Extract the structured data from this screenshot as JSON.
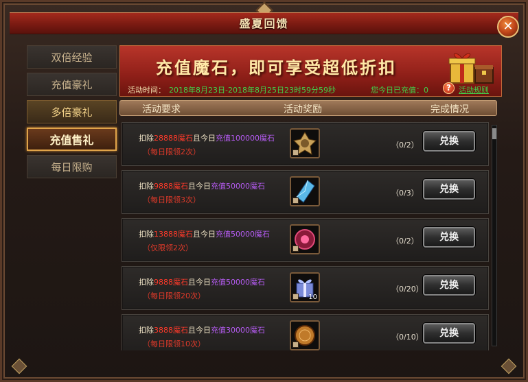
{
  "window": {
    "title": "盛夏回馈"
  },
  "tabs": [
    {
      "label": "双倍经验"
    },
    {
      "label": "充值豪礼"
    },
    {
      "label": "多倍豪礼"
    },
    {
      "label": "充值售礼"
    },
    {
      "label": "每日限购"
    }
  ],
  "banner": {
    "headline": "充值魔石，即可享受超低折扣",
    "time_label": "活动时间：",
    "time_range": "2018年8月23日-2018年8月25日23时59分59秒",
    "charged_text": "您今日已充值：0",
    "help_glyph": "?",
    "rules_link": "活动规则"
  },
  "columns": {
    "requirement": "活动要求",
    "reward": "活动奖励",
    "status": "完成情况"
  },
  "rows": [
    {
      "deduct_prefix": "扣除",
      "deduct_amount": "28888魔石",
      "mid": "且今日",
      "charge_text": "充值100000魔石",
      "limit": "（每日限领2次）",
      "item_icon": "medal-icon",
      "item_qty": "",
      "progress": "（0/2）",
      "button": "兑换"
    },
    {
      "deduct_prefix": "扣除",
      "deduct_amount": "9888魔石",
      "mid": "且今日",
      "charge_text": "充值50000魔石",
      "limit": "（每日限领3次）",
      "item_icon": "crystal-icon",
      "item_qty": "",
      "progress": "（0/3）",
      "button": "兑换"
    },
    {
      "deduct_prefix": "扣除",
      "deduct_amount": "13888魔石",
      "mid": "且今日",
      "charge_text": "充值50000魔石",
      "limit": "（仅限领2次）",
      "item_icon": "orb-icon",
      "item_qty": "",
      "progress": "（0/2）",
      "button": "兑换"
    },
    {
      "deduct_prefix": "扣除",
      "deduct_amount": "9888魔石",
      "mid": "且今日",
      "charge_text": "充值50000魔石",
      "limit": "（每日限领20次）",
      "item_icon": "gift-box-icon",
      "item_qty": "10",
      "progress": "（0/20）",
      "button": "兑换"
    },
    {
      "deduct_prefix": "扣除",
      "deduct_amount": "3888魔石",
      "mid": "且今日",
      "charge_text": "充值30000魔石",
      "limit": "（每日限领10次）",
      "item_icon": "coin-icon",
      "item_qty": "",
      "progress": "（0/10）",
      "button": "兑换"
    }
  ],
  "close_glyph": "✕"
}
